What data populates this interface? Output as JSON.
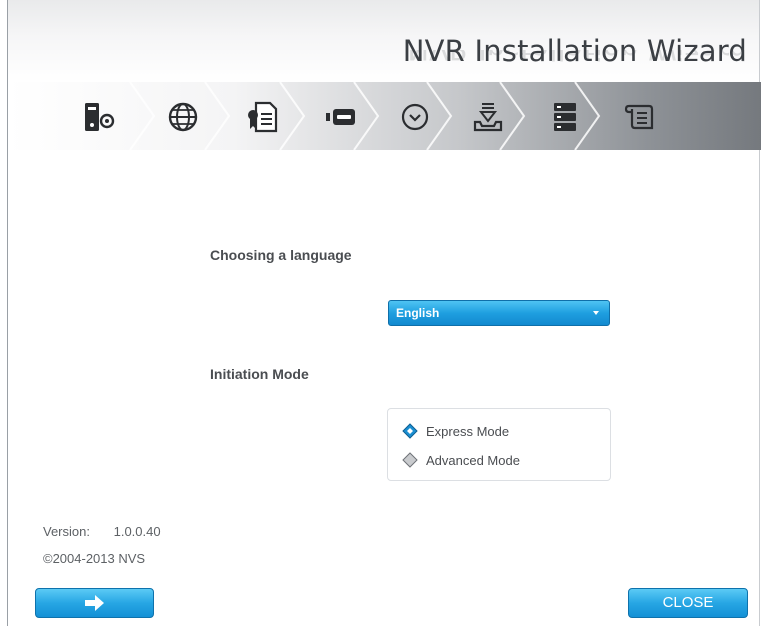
{
  "window": {
    "title": "NVR Installation Wizard"
  },
  "steps": [
    {
      "icon": "server-settings-icon"
    },
    {
      "icon": "globe-icon"
    },
    {
      "icon": "license-document-icon"
    },
    {
      "icon": "storage-drive-icon"
    },
    {
      "icon": "clock-icon"
    },
    {
      "icon": "install-tray-icon"
    },
    {
      "icon": "server-rack-icon"
    },
    {
      "icon": "scroll-icon"
    }
  ],
  "language": {
    "label": "Choosing a language",
    "selected": "English"
  },
  "initiation": {
    "label": "Initiation Mode",
    "options": [
      {
        "label": "Express Mode",
        "selected": true
      },
      {
        "label": "Advanced Mode",
        "selected": false
      }
    ]
  },
  "version": {
    "label": "Version:",
    "value": "1.0.0.40",
    "copyright": "©2004-2013 NVS"
  },
  "buttons": {
    "next_icon": "arrow-right-icon",
    "close": "CLOSE"
  },
  "colors": {
    "accent": "#1f9fe0",
    "accent_dark": "#0f6fa9"
  }
}
